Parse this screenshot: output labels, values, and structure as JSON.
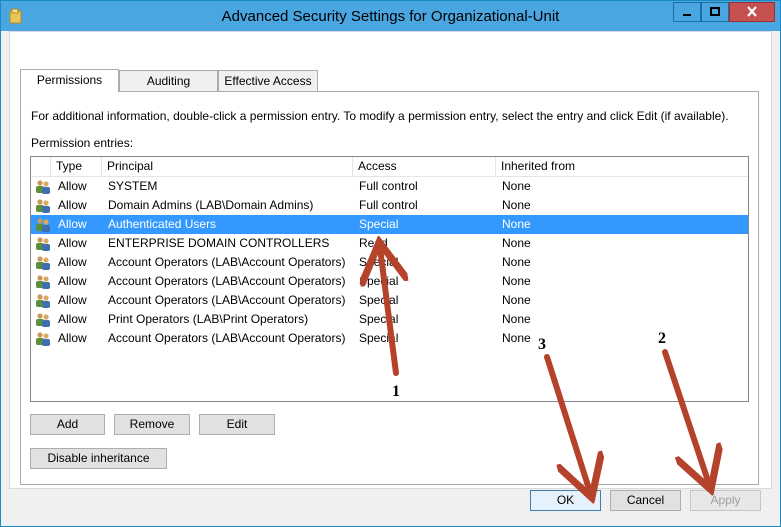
{
  "window": {
    "title": "Advanced Security Settings for Organizational-Unit"
  },
  "tabs": [
    {
      "label": "Permissions",
      "active": true
    },
    {
      "label": "Auditing",
      "active": false
    },
    {
      "label": "Effective Access",
      "active": false
    }
  ],
  "info_text": "For additional information, double-click a permission entry. To modify a permission entry, select the entry and click Edit (if available).",
  "entries_label": "Permission entries:",
  "columns": [
    "Type",
    "Principal",
    "Access",
    "Inherited from"
  ],
  "rows": [
    {
      "type": "Allow",
      "principal": "SYSTEM",
      "access": "Full control",
      "inherited": "None",
      "selected": false
    },
    {
      "type": "Allow",
      "principal": "Domain Admins (LAB\\Domain Admins)",
      "access": "Full control",
      "inherited": "None",
      "selected": false
    },
    {
      "type": "Allow",
      "principal": "Authenticated Users",
      "access": "Special",
      "inherited": "None",
      "selected": true
    },
    {
      "type": "Allow",
      "principal": "ENTERPRISE DOMAIN CONTROLLERS",
      "access": "Read",
      "inherited": "None",
      "selected": false
    },
    {
      "type": "Allow",
      "principal": "Account Operators (LAB\\Account Operators)",
      "access": "Special",
      "inherited": "None",
      "selected": false
    },
    {
      "type": "Allow",
      "principal": "Account Operators (LAB\\Account Operators)",
      "access": "Special",
      "inherited": "None",
      "selected": false
    },
    {
      "type": "Allow",
      "principal": "Account Operators (LAB\\Account Operators)",
      "access": "Special",
      "inherited": "None",
      "selected": false
    },
    {
      "type": "Allow",
      "principal": "Print Operators (LAB\\Print Operators)",
      "access": "Special",
      "inherited": "None",
      "selected": false
    },
    {
      "type": "Allow",
      "principal": "Account Operators (LAB\\Account Operators)",
      "access": "Special",
      "inherited": "None",
      "selected": false
    }
  ],
  "buttons": {
    "add": "Add",
    "remove": "Remove",
    "edit": "Edit",
    "disable_inheritance": "Disable inheritance",
    "ok": "OK",
    "cancel": "Cancel",
    "apply": "Apply"
  },
  "annotations": [
    "1",
    "2",
    "3"
  ],
  "colors": {
    "title_bar": "#4aa6e0",
    "selection": "#3399ff",
    "arrow": "#b5422a",
    "close_button": "#c75050"
  },
  "icons": {
    "title": "folder-icon",
    "entry": "users-icon",
    "minimize": "minimize-icon",
    "maximize": "maximize-icon",
    "close": "close-icon"
  }
}
